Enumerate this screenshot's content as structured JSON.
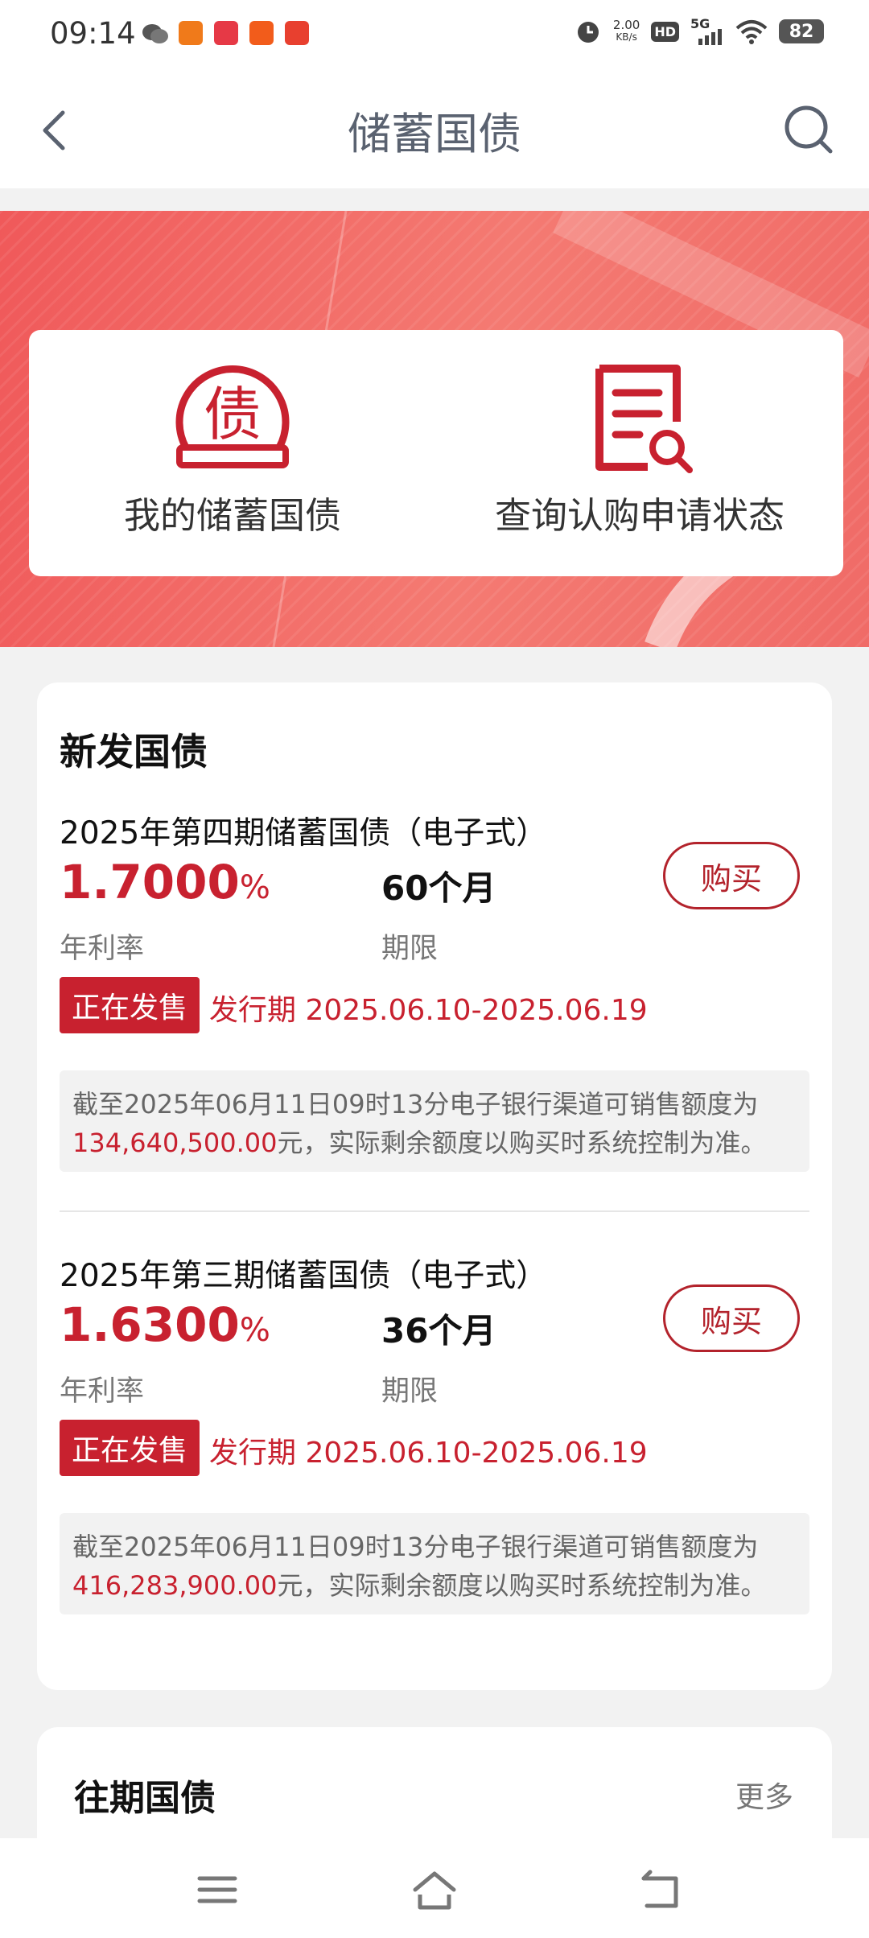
{
  "status_bar": {
    "time": "09:14",
    "speed": "2.00",
    "speed_unit": "KB/s",
    "hd": "HD",
    "network": "5G",
    "battery": "82"
  },
  "nav": {
    "title": "储蓄国债"
  },
  "quick_actions": [
    {
      "icon": "bond-icon",
      "icon_text": "债",
      "label": "我的储蓄国债"
    },
    {
      "icon": "document-search-icon",
      "label": "查询认购申请状态"
    }
  ],
  "new_bonds": {
    "title": "新发国债",
    "items": [
      {
        "name": "2025年第四期储蓄国债（电子式）",
        "rate": "1.7000",
        "rate_unit": "%",
        "rate_label": "年利率",
        "term": "60个月",
        "term_label": "期限",
        "buy_label": "购买",
        "status": "正在发售",
        "period": "发行期 2025.06.10-2025.06.19",
        "notice_prefix": "截至2025年06月11日09时13分电子银行渠道可销售额度为",
        "notice_amount": "134,640,500.00",
        "notice_suffix": "元，实际剩余额度以购买时系统控制为准。"
      },
      {
        "name": "2025年第三期储蓄国债（电子式）",
        "rate": "1.6300",
        "rate_unit": "%",
        "rate_label": "年利率",
        "term": "36个月",
        "term_label": "期限",
        "buy_label": "购买",
        "status": "正在发售",
        "period": "发行期 2025.06.10-2025.06.19",
        "notice_prefix": "截至2025年06月11日09时13分电子银行渠道可销售额度为",
        "notice_amount": "416,283,900.00",
        "notice_suffix": "元，实际剩余额度以购买时系统控制为准。"
      }
    ]
  },
  "past_bonds": {
    "title": "往期国债",
    "more": "更多"
  },
  "colors": {
    "accent": "#c8212f",
    "banner": "#f0595a"
  }
}
